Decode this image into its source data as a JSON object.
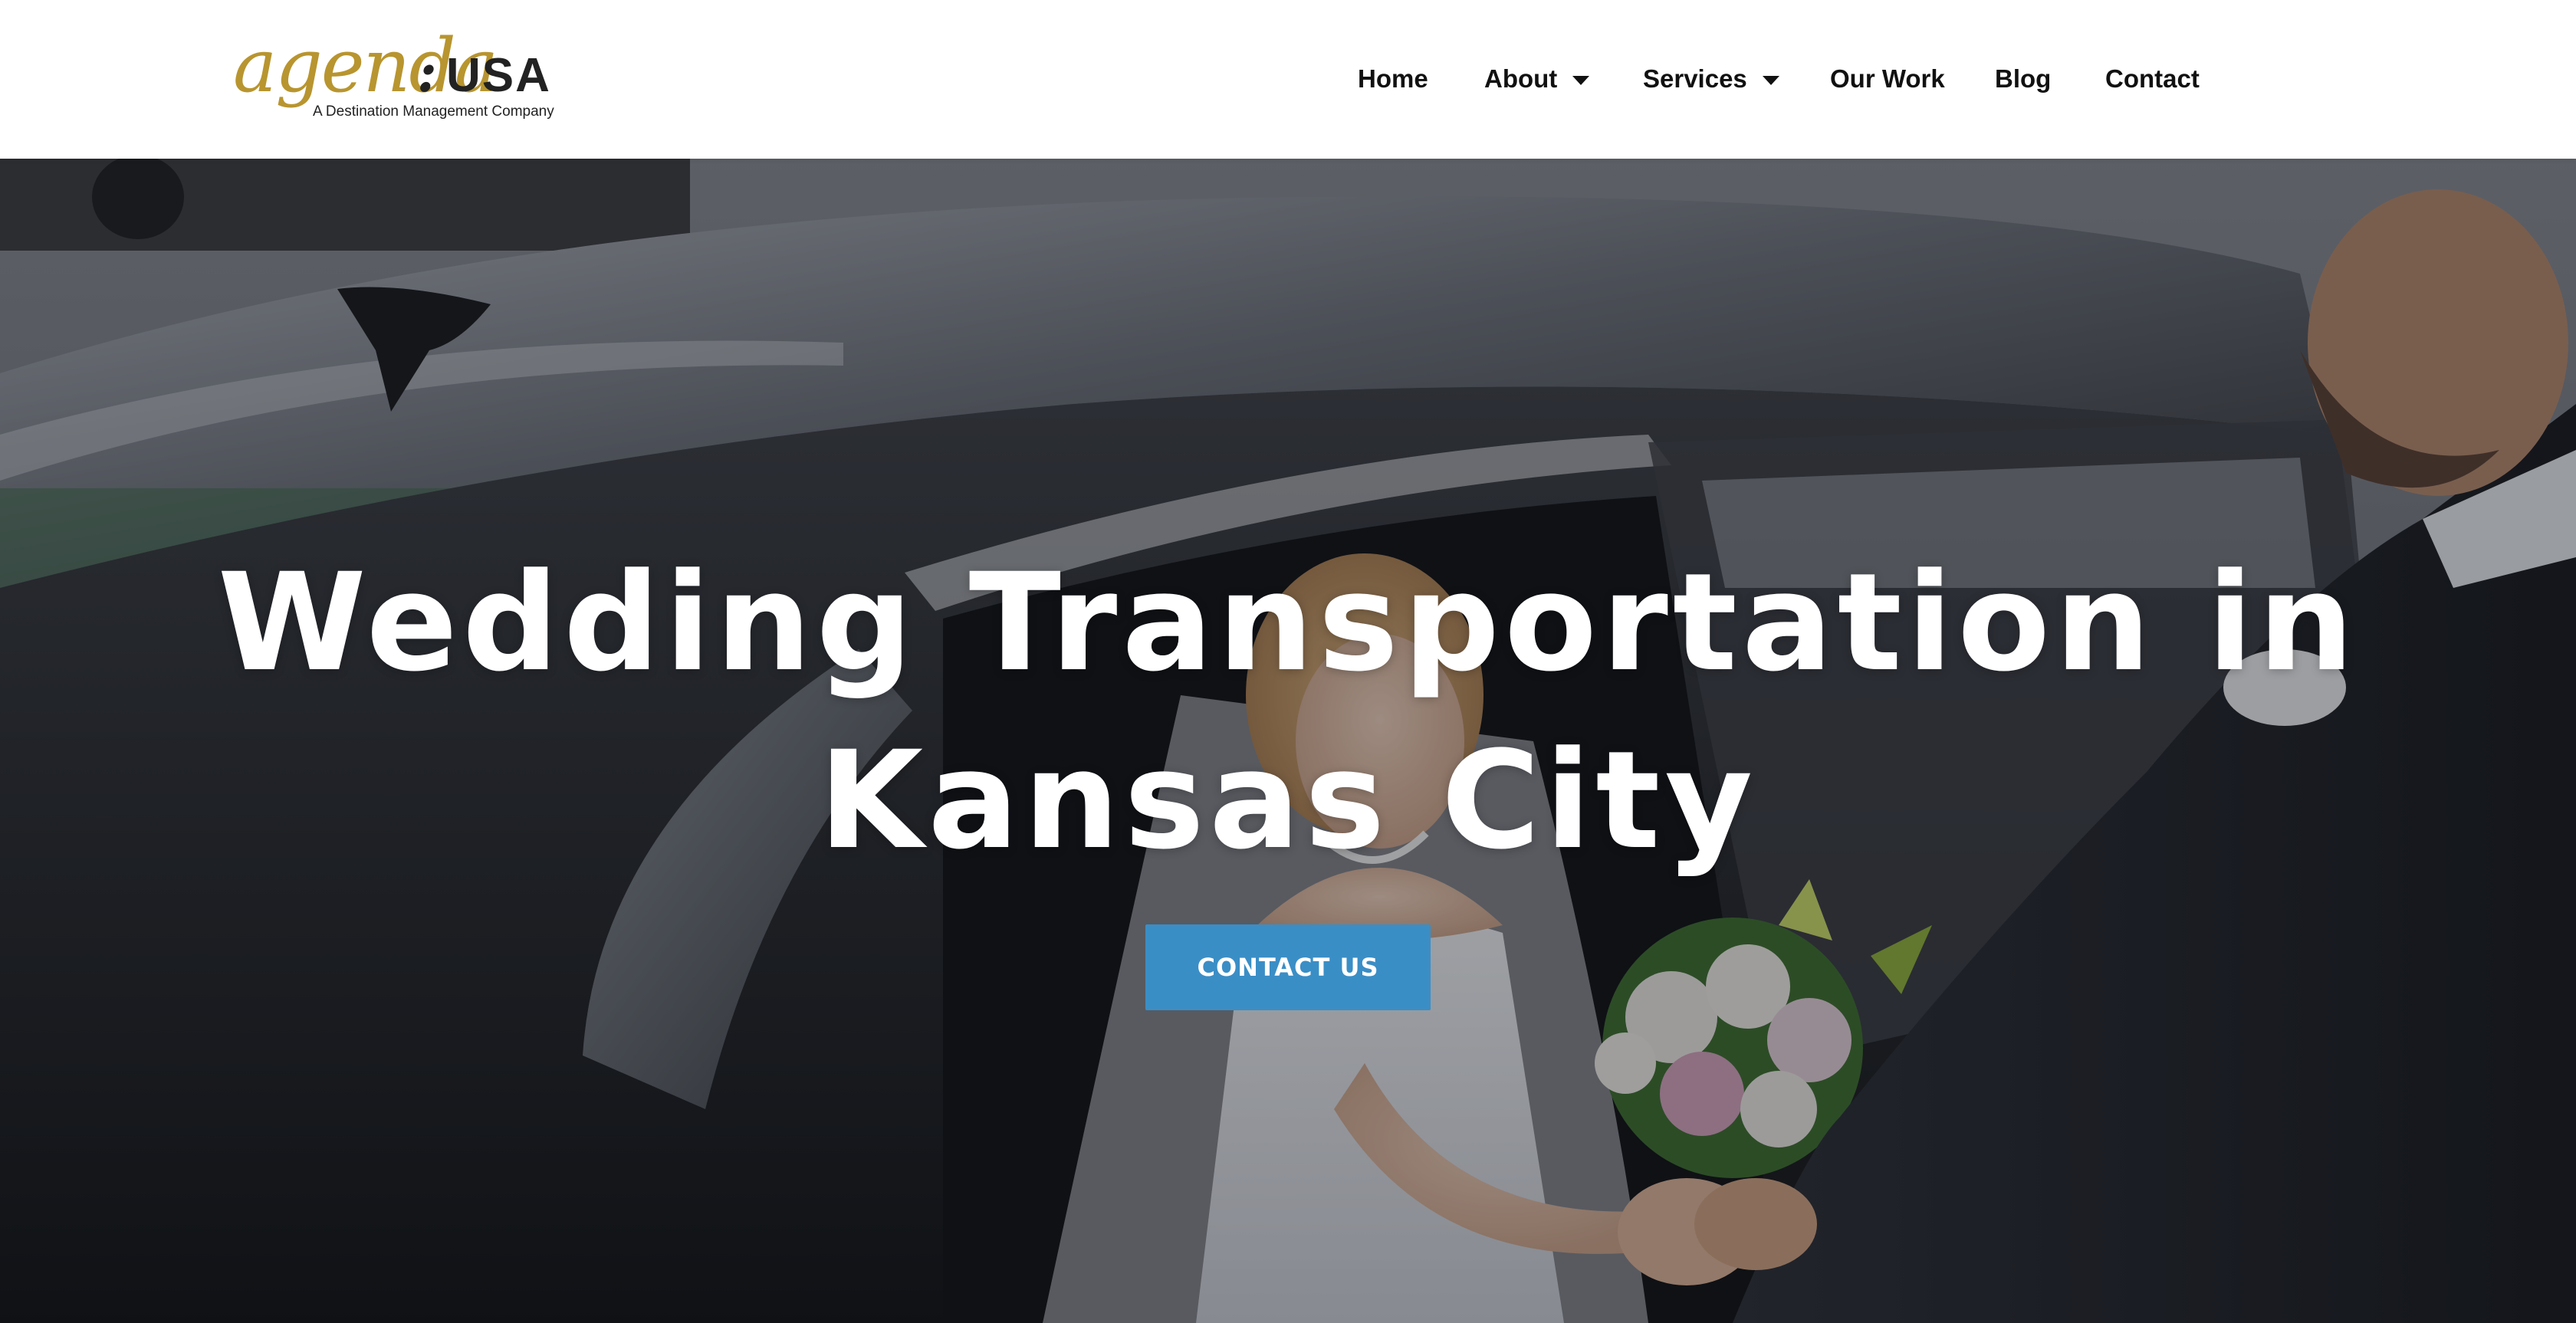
{
  "brand": {
    "script": "agenda",
    "colon": ":",
    "suffix": "USA",
    "tagline": "A Destination Management Company",
    "gold": "#b8952f"
  },
  "nav": {
    "items": [
      {
        "label": "Home",
        "has_dropdown": false
      },
      {
        "label": "About",
        "has_dropdown": true
      },
      {
        "label": "Services",
        "has_dropdown": true
      },
      {
        "label": "Our Work",
        "has_dropdown": false
      },
      {
        "label": "Blog",
        "has_dropdown": false
      },
      {
        "label": "Contact",
        "has_dropdown": false
      }
    ]
  },
  "hero": {
    "title_line1": "Wedding Transportation in",
    "title_line2": "Kansas City",
    "cta_label": "CONTACT US",
    "cta_color": "#3a8ec6",
    "image_subject": "bride stepping out of black car holding bouquet, groom holding her hand"
  }
}
